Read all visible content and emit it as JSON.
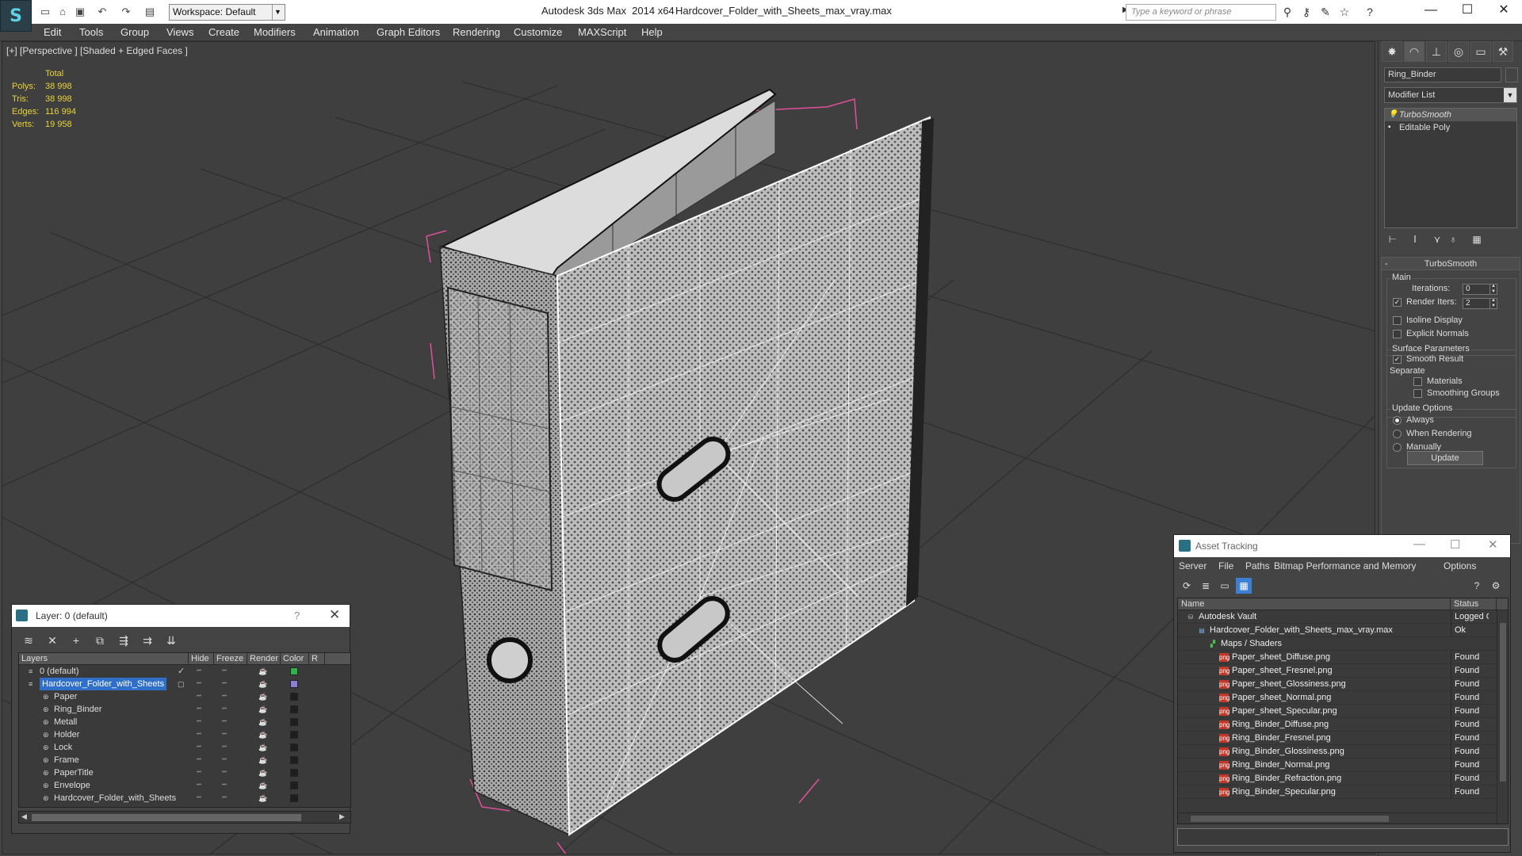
{
  "titlebar": {
    "app_title": "Autodesk 3ds Max  2014 x64",
    "file_name": "Hardcover_Folder_with_Sheets_max_vray.max",
    "workspace": "Workspace: Default",
    "search_placeholder": "Type a keyword or phrase"
  },
  "menu": [
    "Edit",
    "Tools",
    "Group",
    "Views",
    "Create",
    "Modifiers",
    "Animation",
    "Graph Editors",
    "Rendering",
    "Customize",
    "MAXScript",
    "Help"
  ],
  "viewport": {
    "label": "[+] [Perspective ] [Shaded + Edged Faces ]",
    "stats": {
      "header": "Total",
      "rows": [
        {
          "k": "Polys:",
          "v": "38 998"
        },
        {
          "k": "Tris:",
          "v": "38 998"
        },
        {
          "k": "Edges:",
          "v": "116 994"
        },
        {
          "k": "Verts:",
          "v": "19 958"
        }
      ]
    }
  },
  "command_panel": {
    "object_name": "Ring_Binder",
    "modifier_list": "Modifier List",
    "stack": [
      "TurboSmooth",
      "Editable Poly"
    ],
    "rollout_title": "TurboSmooth",
    "main_label": "Main",
    "iterations_label": "Iterations:",
    "iterations_value": "0",
    "render_iters_label": "Render Iters:",
    "render_iters_value": "2",
    "isoline_label": "Isoline Display",
    "explicit_normals_label": "Explicit Normals",
    "surface_params_label": "Surface Parameters",
    "smooth_result_label": "Smooth Result",
    "separate_label": "Separate",
    "materials_label": "Materials",
    "smoothing_groups_label": "Smoothing Groups",
    "update_options_label": "Update Options",
    "always_label": "Always",
    "when_rendering_label": "When Rendering",
    "manually_label": "Manually",
    "update_button": "Update"
  },
  "layer_window": {
    "title": "Layer: 0 (default)",
    "help": "?",
    "columns": [
      "Layers",
      "Hide",
      "Freeze",
      "Render",
      "Color",
      "R"
    ],
    "rows": [
      {
        "name": "0 (default)",
        "indent": 0,
        "color": "#2db34a",
        "check": "✓"
      },
      {
        "name": "Hardcover_Folder_with_Sheets",
        "indent": 0,
        "color": "#8c7fd6",
        "selected": true
      },
      {
        "name": "Paper",
        "indent": 1,
        "color": "#1e1e1e"
      },
      {
        "name": "Ring_Binder",
        "indent": 1,
        "color": "#1e1e1e"
      },
      {
        "name": "Metall",
        "indent": 1,
        "color": "#1e1e1e"
      },
      {
        "name": "Holder",
        "indent": 1,
        "color": "#1e1e1e"
      },
      {
        "name": "Lock",
        "indent": 1,
        "color": "#1e1e1e"
      },
      {
        "name": "Frame",
        "indent": 1,
        "color": "#1e1e1e"
      },
      {
        "name": "PaperTitle",
        "indent": 1,
        "color": "#1e1e1e"
      },
      {
        "name": "Envelope",
        "indent": 1,
        "color": "#1e1e1e"
      },
      {
        "name": "Hardcover_Folder_with_Sheets",
        "indent": 1,
        "color": "#1e1e1e"
      }
    ]
  },
  "asset_window": {
    "title": "Asset Tracking",
    "menu": [
      "Server",
      "File",
      "Paths",
      "Bitmap Performance and Memory",
      "Options"
    ],
    "columns": [
      "Name",
      "Status"
    ],
    "rows": [
      {
        "name": "Autodesk Vault",
        "status": "Logged O",
        "indent": 0,
        "icon": "vault"
      },
      {
        "name": "Hardcover_Folder_with_Sheets_max_vray.max",
        "status": "Ok",
        "indent": 1,
        "icon": "file"
      },
      {
        "name": "Maps / Shaders",
        "status": "",
        "indent": 2,
        "icon": "maps"
      },
      {
        "name": "Paper_sheet_Diffuse.png",
        "status": "Found",
        "indent": 3,
        "icon": "png"
      },
      {
        "name": "Paper_sheet_Fresnel.png",
        "status": "Found",
        "indent": 3,
        "icon": "png"
      },
      {
        "name": "Paper_sheet_Glossiness.png",
        "status": "Found",
        "indent": 3,
        "icon": "png"
      },
      {
        "name": "Paper_sheet_Normal.png",
        "status": "Found",
        "indent": 3,
        "icon": "png"
      },
      {
        "name": "Paper_sheet_Specular.png",
        "status": "Found",
        "indent": 3,
        "icon": "png"
      },
      {
        "name": "Ring_Binder_Diffuse.png",
        "status": "Found",
        "indent": 3,
        "icon": "png"
      },
      {
        "name": "Ring_Binder_Fresnel.png",
        "status": "Found",
        "indent": 3,
        "icon": "png"
      },
      {
        "name": "Ring_Binder_Glossiness.png",
        "status": "Found",
        "indent": 3,
        "icon": "png"
      },
      {
        "name": "Ring_Binder_Normal.png",
        "status": "Found",
        "indent": 3,
        "icon": "png"
      },
      {
        "name": "Ring_Binder_Refraction.png",
        "status": "Found",
        "indent": 3,
        "icon": "png"
      },
      {
        "name": "Ring_Binder_Specular.png",
        "status": "Found",
        "indent": 3,
        "icon": "png"
      }
    ]
  },
  "colors": {
    "stats_text": "#e8d23a",
    "selection": "#2f6fc9",
    "bbox": "#e0509a",
    "grid": "#2b2b2b"
  }
}
